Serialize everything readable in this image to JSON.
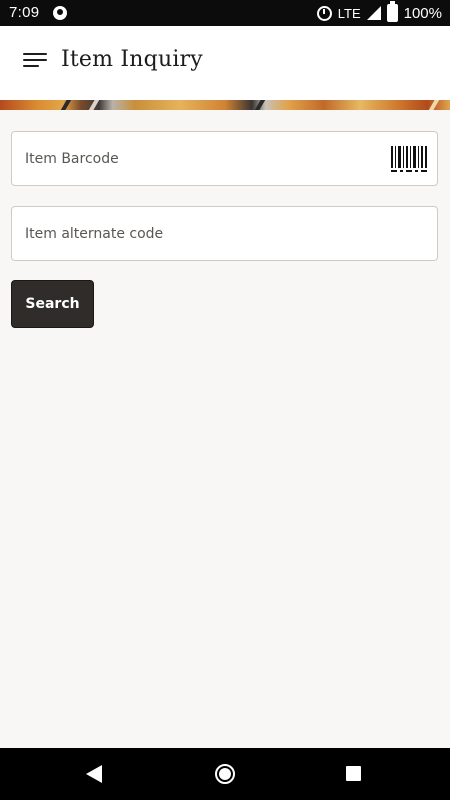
{
  "status_bar": {
    "time": "7:09",
    "network": "LTE",
    "battery": "100%",
    "icons": [
      "app-notification-icon",
      "alarm-icon",
      "signal-icon",
      "battery-icon"
    ]
  },
  "header": {
    "title": "Item Inquiry",
    "menu_icon": "hamburger-menu-icon"
  },
  "form": {
    "barcode": {
      "value": "",
      "placeholder": "Item Barcode",
      "scan_icon": "barcode-icon"
    },
    "alternate_code": {
      "value": "",
      "placeholder": "Item alternate code"
    },
    "search_label": "Search"
  },
  "nav_bar": {
    "icons": [
      "back-icon",
      "home-icon",
      "recents-icon"
    ]
  },
  "colors": {
    "background": "#f8f7f5",
    "header": "#ffffff",
    "button": "#2f2c29",
    "field_border": "#cfcac4",
    "status_bar": "#0c0c0c",
    "nav_bar": "#000000"
  }
}
